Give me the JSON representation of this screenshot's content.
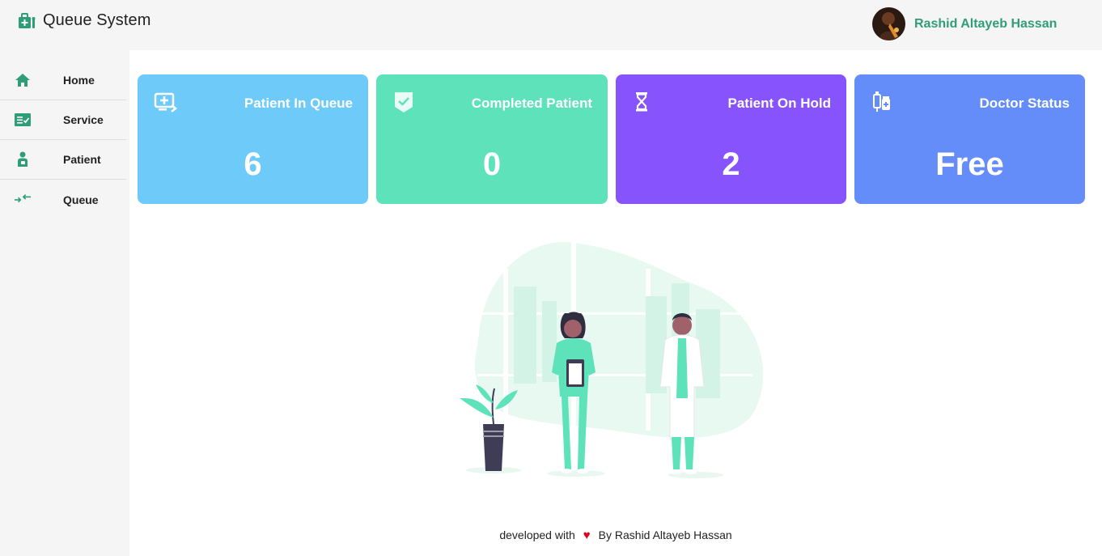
{
  "header": {
    "title": "Queue System",
    "user_name": "Rashid Altayeb Hassan",
    "brand_icon": "medical-kit-icon"
  },
  "sidebar": {
    "items": [
      {
        "label": "Home",
        "icon": "home-icon"
      },
      {
        "label": "Service",
        "icon": "checklist-icon"
      },
      {
        "label": "Patient",
        "icon": "patient-icon"
      },
      {
        "label": "Queue",
        "icon": "queue-arrows-icon"
      }
    ]
  },
  "cards": [
    {
      "title": "Patient In Queue",
      "value": "6",
      "icon": "monitor-plus-icon",
      "color": "#6ecbf9"
    },
    {
      "title": "Completed Patient",
      "value": "0",
      "icon": "shield-check-icon",
      "color": "#5ee2b9"
    },
    {
      "title": "Patient On Hold",
      "value": "2",
      "icon": "hourglass-icon",
      "color": "#8653fc"
    },
    {
      "title": "Doctor Status",
      "value": "Free",
      "icon": "medicine-icon",
      "color": "#648df9"
    }
  ],
  "footer": {
    "prefix": "developed with",
    "heart": "♥",
    "suffix": "By Rashid Altayeb Hassan"
  },
  "colors": {
    "accent": "#2f9e78",
    "illustration_green": "#5ee2b9"
  }
}
